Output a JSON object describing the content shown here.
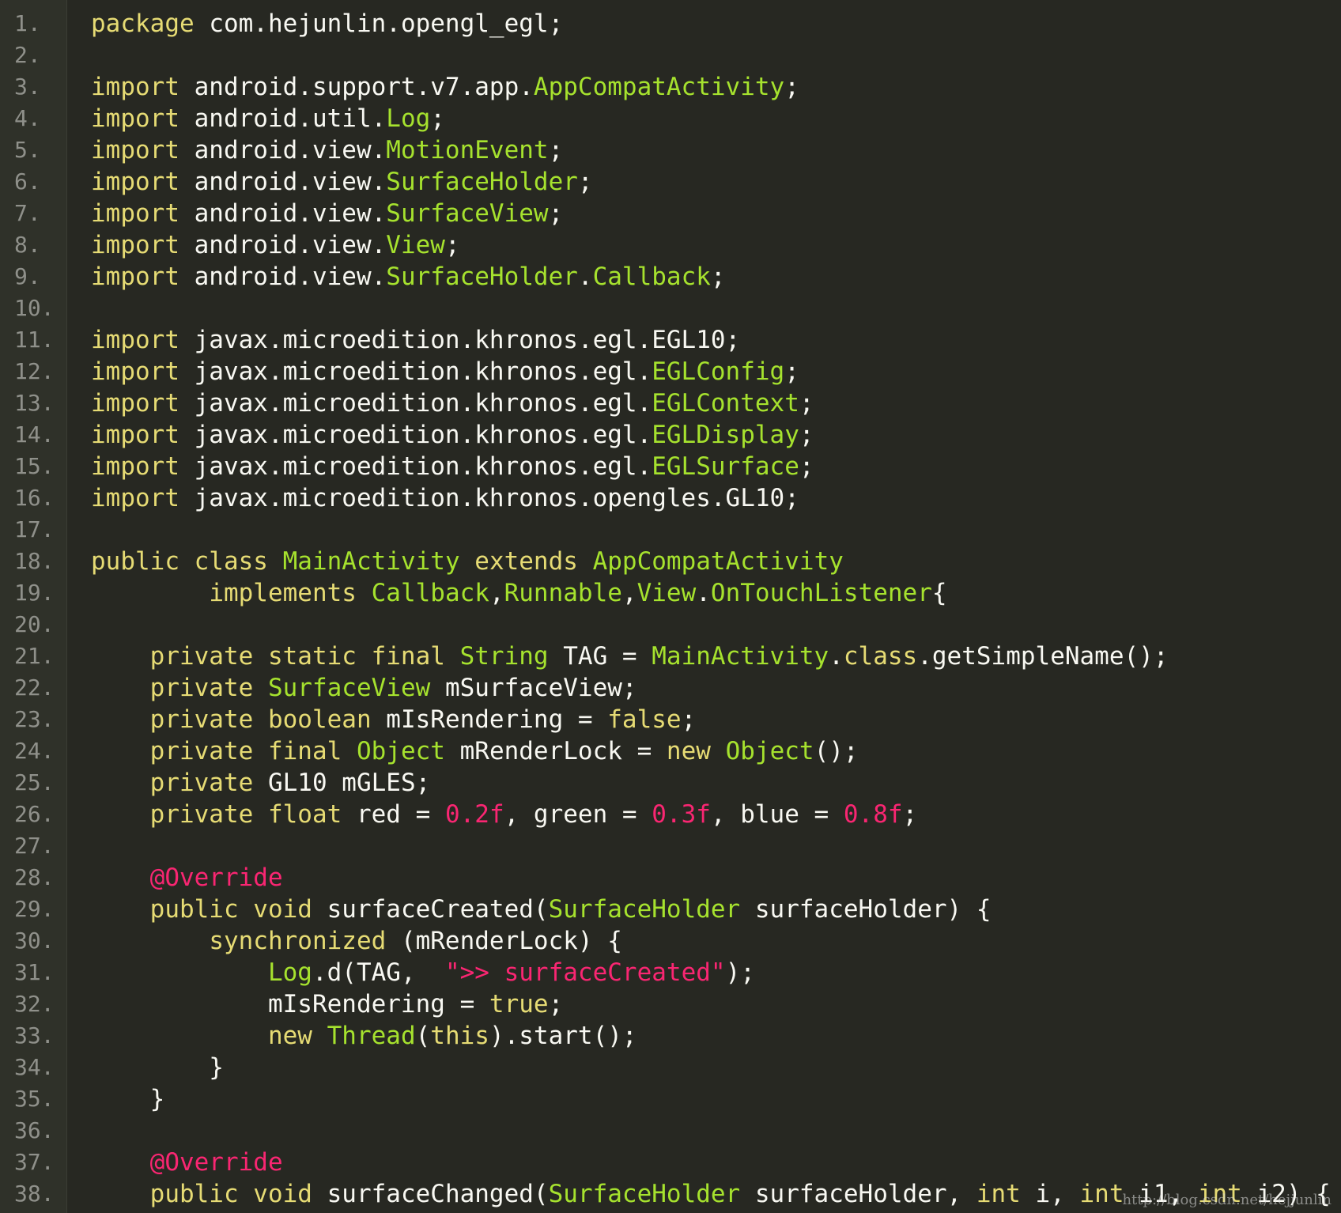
{
  "colors": {
    "background": "#272822",
    "gutter": "#2f3129",
    "line_number": "#8f908a",
    "plain": "#f8f8f2",
    "keyword": "#e6db74",
    "type": "#a6e22e",
    "literal": "#f92672"
  },
  "lines": [
    {
      "n": "1.",
      "tokens": [
        {
          "t": "package",
          "k": "kw"
        },
        {
          "t": " com.hejunlin.opengl_egl;",
          "k": "pl"
        }
      ]
    },
    {
      "n": "2.",
      "tokens": []
    },
    {
      "n": "3.",
      "tokens": [
        {
          "t": "import",
          "k": "kw"
        },
        {
          "t": " android.support.v7.app.",
          "k": "pl"
        },
        {
          "t": "AppCompatActivity",
          "k": "ty"
        },
        {
          "t": ";",
          "k": "pl"
        }
      ]
    },
    {
      "n": "4.",
      "tokens": [
        {
          "t": "import",
          "k": "kw"
        },
        {
          "t": " android.util.",
          "k": "pl"
        },
        {
          "t": "Log",
          "k": "ty"
        },
        {
          "t": ";",
          "k": "pl"
        }
      ]
    },
    {
      "n": "5.",
      "tokens": [
        {
          "t": "import",
          "k": "kw"
        },
        {
          "t": " android.view.",
          "k": "pl"
        },
        {
          "t": "MotionEvent",
          "k": "ty"
        },
        {
          "t": ";",
          "k": "pl"
        }
      ]
    },
    {
      "n": "6.",
      "tokens": [
        {
          "t": "import",
          "k": "kw"
        },
        {
          "t": " android.view.",
          "k": "pl"
        },
        {
          "t": "SurfaceHolder",
          "k": "ty"
        },
        {
          "t": ";",
          "k": "pl"
        }
      ]
    },
    {
      "n": "7.",
      "tokens": [
        {
          "t": "import",
          "k": "kw"
        },
        {
          "t": " android.view.",
          "k": "pl"
        },
        {
          "t": "SurfaceView",
          "k": "ty"
        },
        {
          "t": ";",
          "k": "pl"
        }
      ]
    },
    {
      "n": "8.",
      "tokens": [
        {
          "t": "import",
          "k": "kw"
        },
        {
          "t": " android.view.",
          "k": "pl"
        },
        {
          "t": "View",
          "k": "ty"
        },
        {
          "t": ";",
          "k": "pl"
        }
      ]
    },
    {
      "n": "9.",
      "tokens": [
        {
          "t": "import",
          "k": "kw"
        },
        {
          "t": " android.view.",
          "k": "pl"
        },
        {
          "t": "SurfaceHolder",
          "k": "ty"
        },
        {
          "t": ".",
          "k": "pl"
        },
        {
          "t": "Callback",
          "k": "ty"
        },
        {
          "t": ";",
          "k": "pl"
        }
      ]
    },
    {
      "n": "10.",
      "tokens": []
    },
    {
      "n": "11.",
      "tokens": [
        {
          "t": "import",
          "k": "kw"
        },
        {
          "t": " javax.microedition.khronos.egl.EGL10;",
          "k": "pl"
        }
      ]
    },
    {
      "n": "12.",
      "tokens": [
        {
          "t": "import",
          "k": "kw"
        },
        {
          "t": " javax.microedition.khronos.egl.",
          "k": "pl"
        },
        {
          "t": "EGLConfig",
          "k": "ty"
        },
        {
          "t": ";",
          "k": "pl"
        }
      ]
    },
    {
      "n": "13.",
      "tokens": [
        {
          "t": "import",
          "k": "kw"
        },
        {
          "t": " javax.microedition.khronos.egl.",
          "k": "pl"
        },
        {
          "t": "EGLContext",
          "k": "ty"
        },
        {
          "t": ";",
          "k": "pl"
        }
      ]
    },
    {
      "n": "14.",
      "tokens": [
        {
          "t": "import",
          "k": "kw"
        },
        {
          "t": " javax.microedition.khronos.egl.",
          "k": "pl"
        },
        {
          "t": "EGLDisplay",
          "k": "ty"
        },
        {
          "t": ";",
          "k": "pl"
        }
      ]
    },
    {
      "n": "15.",
      "tokens": [
        {
          "t": "import",
          "k": "kw"
        },
        {
          "t": " javax.microedition.khronos.egl.",
          "k": "pl"
        },
        {
          "t": "EGLSurface",
          "k": "ty"
        },
        {
          "t": ";",
          "k": "pl"
        }
      ]
    },
    {
      "n": "16.",
      "tokens": [
        {
          "t": "import",
          "k": "kw"
        },
        {
          "t": " javax.microedition.khronos.opengles.GL10;",
          "k": "pl"
        }
      ]
    },
    {
      "n": "17.",
      "tokens": []
    },
    {
      "n": "18.",
      "tokens": [
        {
          "t": "public class",
          "k": "kw"
        },
        {
          "t": " ",
          "k": "pl"
        },
        {
          "t": "MainActivity",
          "k": "ty"
        },
        {
          "t": " ",
          "k": "pl"
        },
        {
          "t": "extends",
          "k": "kw"
        },
        {
          "t": " ",
          "k": "pl"
        },
        {
          "t": "AppCompatActivity",
          "k": "ty"
        }
      ]
    },
    {
      "n": "19.",
      "tokens": [
        {
          "t": "        ",
          "k": "pl"
        },
        {
          "t": "implements",
          "k": "kw"
        },
        {
          "t": " ",
          "k": "pl"
        },
        {
          "t": "Callback",
          "k": "ty"
        },
        {
          "t": ",",
          "k": "pl"
        },
        {
          "t": "Runnable",
          "k": "ty"
        },
        {
          "t": ",",
          "k": "pl"
        },
        {
          "t": "View",
          "k": "ty"
        },
        {
          "t": ".",
          "k": "pl"
        },
        {
          "t": "OnTouchListener",
          "k": "ty"
        },
        {
          "t": "{",
          "k": "pl"
        }
      ]
    },
    {
      "n": "20.",
      "tokens": []
    },
    {
      "n": "21.",
      "tokens": [
        {
          "t": "    ",
          "k": "pl"
        },
        {
          "t": "private static final",
          "k": "kw"
        },
        {
          "t": " ",
          "k": "pl"
        },
        {
          "t": "String",
          "k": "ty"
        },
        {
          "t": " TAG = ",
          "k": "pl"
        },
        {
          "t": "MainActivity",
          "k": "ty"
        },
        {
          "t": ".",
          "k": "pl"
        },
        {
          "t": "class",
          "k": "kw"
        },
        {
          "t": ".getSimpleName();",
          "k": "pl"
        }
      ]
    },
    {
      "n": "22.",
      "tokens": [
        {
          "t": "    ",
          "k": "pl"
        },
        {
          "t": "private",
          "k": "kw"
        },
        {
          "t": " ",
          "k": "pl"
        },
        {
          "t": "SurfaceView",
          "k": "ty"
        },
        {
          "t": " mSurfaceView;",
          "k": "pl"
        }
      ]
    },
    {
      "n": "23.",
      "tokens": [
        {
          "t": "    ",
          "k": "pl"
        },
        {
          "t": "private boolean",
          "k": "kw"
        },
        {
          "t": " mIsRendering = ",
          "k": "pl"
        },
        {
          "t": "false",
          "k": "kw"
        },
        {
          "t": ";",
          "k": "pl"
        }
      ]
    },
    {
      "n": "24.",
      "tokens": [
        {
          "t": "    ",
          "k": "pl"
        },
        {
          "t": "private final",
          "k": "kw"
        },
        {
          "t": " ",
          "k": "pl"
        },
        {
          "t": "Object",
          "k": "ty"
        },
        {
          "t": " mRenderLock = ",
          "k": "pl"
        },
        {
          "t": "new",
          "k": "kw"
        },
        {
          "t": " ",
          "k": "pl"
        },
        {
          "t": "Object",
          "k": "ty"
        },
        {
          "t": "();",
          "k": "pl"
        }
      ]
    },
    {
      "n": "25.",
      "tokens": [
        {
          "t": "    ",
          "k": "pl"
        },
        {
          "t": "private",
          "k": "kw"
        },
        {
          "t": " GL10 mGLES;",
          "k": "pl"
        }
      ]
    },
    {
      "n": "26.",
      "tokens": [
        {
          "t": "    ",
          "k": "pl"
        },
        {
          "t": "private float",
          "k": "kw"
        },
        {
          "t": " red = ",
          "k": "pl"
        },
        {
          "t": "0.2f",
          "k": "num"
        },
        {
          "t": ", green = ",
          "k": "pl"
        },
        {
          "t": "0.3f",
          "k": "num"
        },
        {
          "t": ", blue = ",
          "k": "pl"
        },
        {
          "t": "0.8f",
          "k": "num"
        },
        {
          "t": ";",
          "k": "pl"
        }
      ]
    },
    {
      "n": "27.",
      "tokens": []
    },
    {
      "n": "28.",
      "tokens": [
        {
          "t": "    ",
          "k": "pl"
        },
        {
          "t": "@Override",
          "k": "ann"
        }
      ]
    },
    {
      "n": "29.",
      "tokens": [
        {
          "t": "    ",
          "k": "pl"
        },
        {
          "t": "public void",
          "k": "kw"
        },
        {
          "t": " surfaceCreated(",
          "k": "pl"
        },
        {
          "t": "SurfaceHolder",
          "k": "ty"
        },
        {
          "t": " surfaceHolder) {",
          "k": "pl"
        }
      ]
    },
    {
      "n": "30.",
      "tokens": [
        {
          "t": "        ",
          "k": "pl"
        },
        {
          "t": "synchronized",
          "k": "kw"
        },
        {
          "t": " (mRenderLock) {",
          "k": "pl"
        }
      ]
    },
    {
      "n": "31.",
      "tokens": [
        {
          "t": "            ",
          "k": "pl"
        },
        {
          "t": "Log",
          "k": "ty"
        },
        {
          "t": ".d(TAG,  ",
          "k": "pl"
        },
        {
          "t": "\">> surfaceCreated\"",
          "k": "str"
        },
        {
          "t": ");",
          "k": "pl"
        }
      ]
    },
    {
      "n": "32.",
      "tokens": [
        {
          "t": "            mIsRendering = ",
          "k": "pl"
        },
        {
          "t": "true",
          "k": "kw"
        },
        {
          "t": ";",
          "k": "pl"
        }
      ]
    },
    {
      "n": "33.",
      "tokens": [
        {
          "t": "            ",
          "k": "pl"
        },
        {
          "t": "new",
          "k": "kw"
        },
        {
          "t": " ",
          "k": "pl"
        },
        {
          "t": "Thread",
          "k": "ty"
        },
        {
          "t": "(",
          "k": "pl"
        },
        {
          "t": "this",
          "k": "kw"
        },
        {
          "t": ").start();",
          "k": "pl"
        }
      ]
    },
    {
      "n": "34.",
      "tokens": [
        {
          "t": "        }",
          "k": "pl"
        }
      ]
    },
    {
      "n": "35.",
      "tokens": [
        {
          "t": "    }",
          "k": "pl"
        }
      ]
    },
    {
      "n": "36.",
      "tokens": []
    },
    {
      "n": "37.",
      "tokens": [
        {
          "t": "    ",
          "k": "pl"
        },
        {
          "t": "@Override",
          "k": "ann"
        }
      ]
    },
    {
      "n": "38.",
      "tokens": [
        {
          "t": "    ",
          "k": "pl"
        },
        {
          "t": "public void",
          "k": "kw"
        },
        {
          "t": " surfaceChanged(",
          "k": "pl"
        },
        {
          "t": "SurfaceHolder",
          "k": "ty"
        },
        {
          "t": " surfaceHolder, ",
          "k": "pl"
        },
        {
          "t": "int",
          "k": "kw"
        },
        {
          "t": " i, ",
          "k": "pl"
        },
        {
          "t": "int",
          "k": "kw"
        },
        {
          "t": " i1, ",
          "k": "pl"
        },
        {
          "t": "int",
          "k": "kw"
        },
        {
          "t": " i2) {",
          "k": "pl"
        }
      ]
    }
  ],
  "watermark": "http://blog.csdn.net/hejjunlin"
}
